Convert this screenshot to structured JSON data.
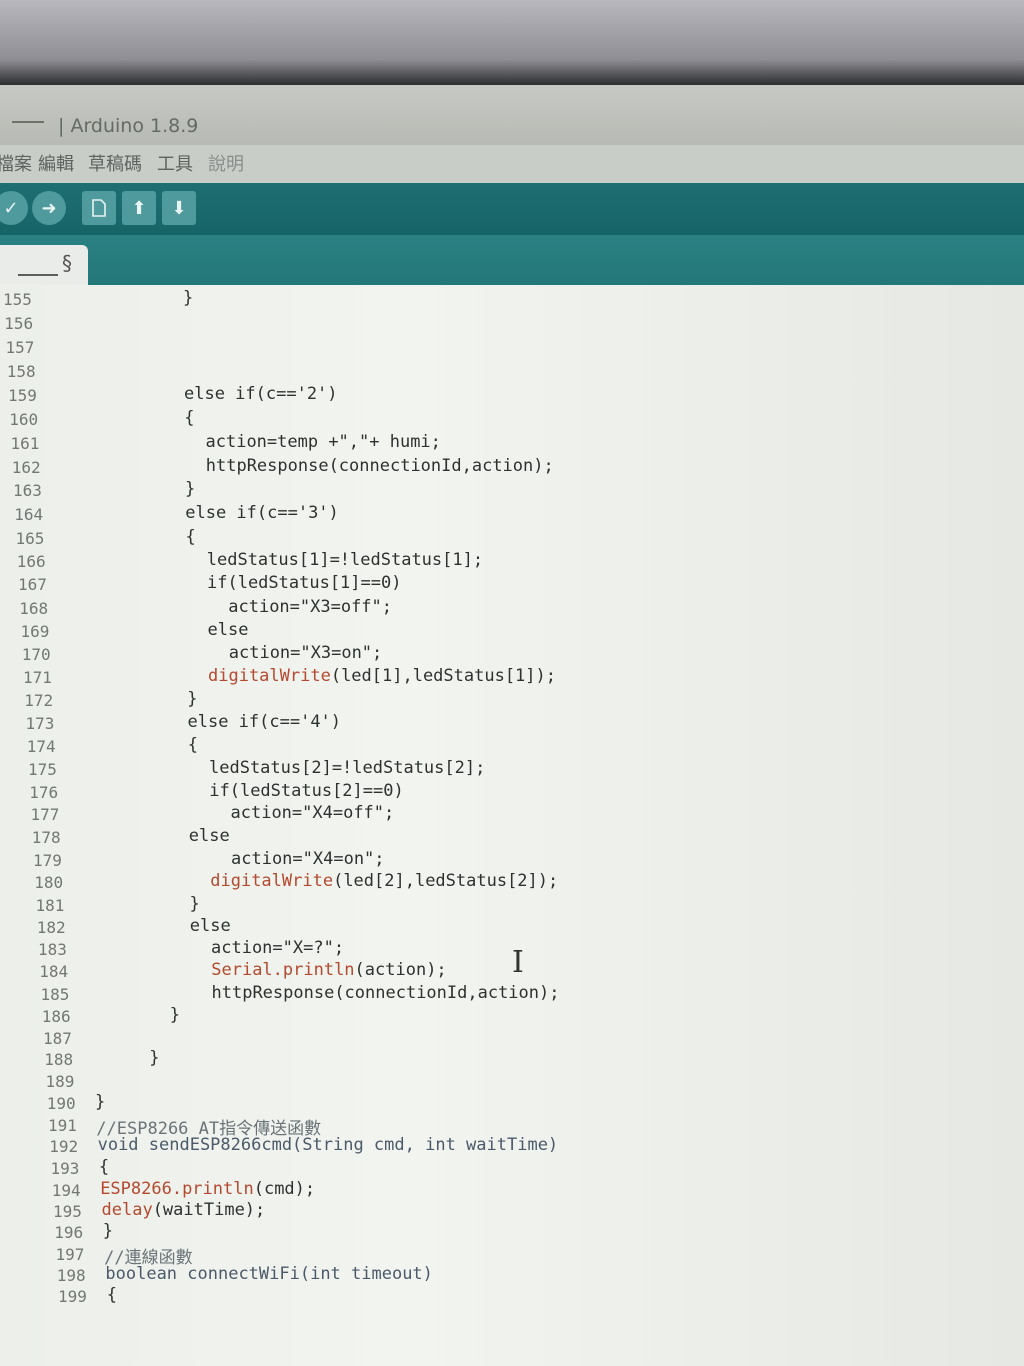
{
  "window": {
    "title": "| Arduino 1.8.9"
  },
  "menu": [
    "檔案",
    "編輯",
    "草稿碼",
    "工具",
    "說明"
  ],
  "toolbar": {
    "verify_icon": "check-icon",
    "upload_icon": "arrow-right-icon",
    "new_icon": "file-icon",
    "open_icon": "arrow-up-icon",
    "save_icon": "arrow-down-icon"
  },
  "tab": {
    "modified_mark": "§"
  },
  "colors": {
    "toolbar": "#176467",
    "function": "#b4492e",
    "editor_bg": "#eef1ec"
  },
  "code": [
    {
      "n": "155",
      "text": "}"
    },
    {
      "n": "156",
      "text": ""
    },
    {
      "n": "157",
      "text": ""
    },
    {
      "n": "158",
      "text": ""
    },
    {
      "n": "159",
      "text": "else if(c=='2')"
    },
    {
      "n": "160",
      "text": "{"
    },
    {
      "n": "161",
      "text": "action=temp +\",\"+ humi;"
    },
    {
      "n": "162",
      "text": "httpResponse(connectionId,action);"
    },
    {
      "n": "163",
      "text": "}"
    },
    {
      "n": "164",
      "text": "else if(c=='3')"
    },
    {
      "n": "165",
      "text": "{"
    },
    {
      "n": "166",
      "text": "ledStatus[1]=!ledStatus[1];"
    },
    {
      "n": "167",
      "text": "if(ledStatus[1]==0)"
    },
    {
      "n": "168",
      "text": "action=\"X3=off\";"
    },
    {
      "n": "169",
      "text": "else"
    },
    {
      "n": "170",
      "text": "action=\"X3=on\";"
    },
    {
      "n": "171",
      "fn": "digitalWrite",
      "text": "(led[1],ledStatus[1]);"
    },
    {
      "n": "172",
      "text": "}"
    },
    {
      "n": "173",
      "text": "else if(c=='4')"
    },
    {
      "n": "174",
      "text": "{"
    },
    {
      "n": "175",
      "text": "ledStatus[2]=!ledStatus[2];"
    },
    {
      "n": "176",
      "text": "if(ledStatus[2]==0)"
    },
    {
      "n": "177",
      "text": "action=\"X4=off\";"
    },
    {
      "n": "178",
      "text": "else"
    },
    {
      "n": "179",
      "text": "action=\"X4=on\";"
    },
    {
      "n": "180",
      "fn": "digitalWrite",
      "text": "(led[2],ledStatus[2]);"
    },
    {
      "n": "181",
      "text": "}"
    },
    {
      "n": "182",
      "text": "else"
    },
    {
      "n": "183",
      "text": "action=\"X=?\";"
    },
    {
      "n": "184",
      "fn": "Serial.println",
      "text": "(action);"
    },
    {
      "n": "185",
      "text": "httpResponse(connectionId,action);"
    },
    {
      "n": "186",
      "text": "}"
    },
    {
      "n": "187",
      "text": ""
    },
    {
      "n": "188",
      "text": "}"
    },
    {
      "n": "189",
      "text": ""
    },
    {
      "n": "190",
      "text": "}"
    },
    {
      "n": "191",
      "text": "//ESP8266 AT指令傳送函數"
    },
    {
      "n": "192",
      "text": "void sendESP8266cmd(String cmd, int waitTime)"
    },
    {
      "n": "193",
      "text": "{"
    },
    {
      "n": "194",
      "fn": "ESP8266.println",
      "text": "(cmd);"
    },
    {
      "n": "195",
      "fn": "delay",
      "text": "(waitTime);"
    },
    {
      "n": "196",
      "text": "}"
    },
    {
      "n": "197",
      "text": "//連線函數"
    },
    {
      "n": "198",
      "text": "boolean connectWiFi(int timeout)"
    },
    {
      "n": "199",
      "text": "{"
    }
  ]
}
